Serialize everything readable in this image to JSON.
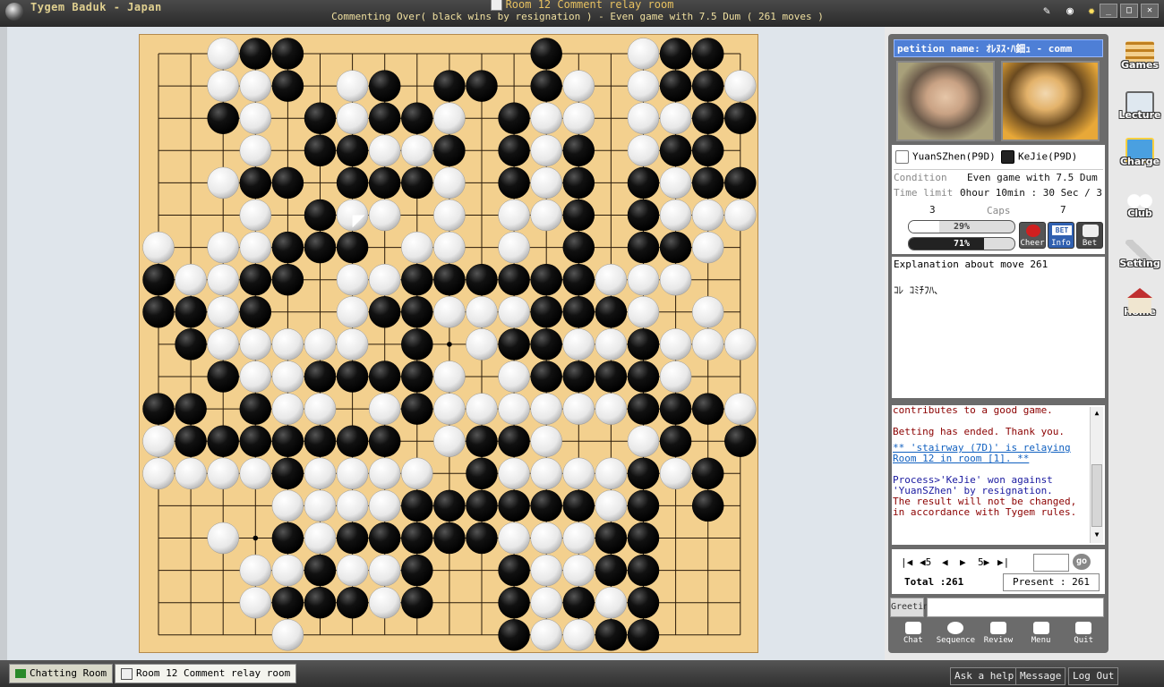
{
  "window": {
    "app_title": "Tygem Baduk - Japan",
    "room_title": "Room 12 Comment relay room",
    "subtitle": "Commenting Over( black wins by resignation ) - Even game with 7.5 Dum  ( 261 moves )"
  },
  "petition": "petition name: ｵﾚﾇｽ･ﾊ鈿ｭ - comm",
  "players": {
    "white": "YuanSZhen(P9D)",
    "black": "KeJie(P9D)"
  },
  "game_info": {
    "condition_label": "Condition",
    "condition_value": "Even game with 7.5 Dum",
    "time_label": "Time limit",
    "time_value": "0hour 10min : 30 Sec / 3",
    "caps_label": "Caps",
    "white_caps": "3",
    "black_caps": "7",
    "white_bet_pct_label": "29%",
    "black_bet_pct_label": "71%",
    "white_bet_fraction": 0.29,
    "black_bet_fraction": 0.71
  },
  "info_buttons": {
    "cheer": "Cheer",
    "info": "Info",
    "bet": "Bet",
    "bet_badge": "BET"
  },
  "explanation": {
    "title": "Explanation about move 261",
    "text": "ｺﾚ ｺﾐﾁﾌﾊ､"
  },
  "chat_lines": [
    {
      "text": "contributes to a good game.",
      "color": "#8b0000"
    },
    {
      "text": "",
      "color": "#000"
    },
    {
      "text": "",
      "color": "#000"
    },
    {
      "text": "Betting has ended. Thank you.",
      "color": "#8b0000"
    },
    {
      "text": "",
      "color": "#000"
    },
    {
      "text": "** 'stairway (7D)' is relaying Room 12 in room [1]. **",
      "color": "#1060c0"
    },
    {
      "text": "",
      "color": "#000"
    },
    {
      "text": "",
      "color": "#000"
    },
    {
      "text": "Process>'KeJie' won against 'YuanSZhen' by resignation.",
      "color": "#1a1aa0"
    },
    {
      "text": "The result will not be changed, in accordance with Tygem rules.",
      "color": "#8b0000"
    }
  ],
  "navigation": {
    "first": "|◀",
    "back5": "◀5",
    "prev": "◀",
    "next": "▶",
    "fwd5": "5▶",
    "last": "▶|",
    "go": "go",
    "total_label": "Total :261",
    "present_label": "Present : 261"
  },
  "greeting_label": "Greeting",
  "bottom_buttons": [
    "Chat",
    "Sequence",
    "Review",
    "Menu",
    "Quit"
  ],
  "sidebar": [
    "Games",
    "Lecture",
    "Charge",
    "Club",
    "Setting",
    "Home"
  ],
  "taskbar": {
    "chatting_room": "Chatting Room",
    "relay_room": "Room 12 Comment relay room",
    "ask_help": "Ask a help",
    "message": "Message",
    "logout": "Log Out"
  },
  "board": {
    "size": 19,
    "last_move": [
      5,
      6
    ],
    "stars": [
      [
        3,
        3
      ],
      [
        3,
        9
      ],
      [
        3,
        15
      ],
      [
        9,
        3
      ],
      [
        9,
        9
      ],
      [
        9,
        15
      ],
      [
        15,
        3
      ],
      [
        15,
        9
      ],
      [
        15,
        15
      ]
    ],
    "rows": [
      "..WBB.......B..WBB.",
      "..WWB.WB.BB.BW.WBBW",
      "..BW.BWBBW.BWW.WWBB",
      "...W.BBWWB.BWB.WBB.",
      "..WBB.BBBW.BWB.BWBB",
      "...W.BWW.W.WWB.BWWW",
      "W.WWBBB.WW.W.B.BBW.",
      "BWWBB.WWBBBBBBWWW..",
      "BBWB..WBBWWWBBBW.W.",
      ".BWWWWW.B.WBBWWBWWW",
      "..BWWBBBBW.WBBBBW..",
      "BB.BWW.WBWWWWWWBBBW",
      "WBBBBBBB.WBBW..WB.B",
      "WWWWBWWWW.BWWWWBWB.",
      "....WWWWBBBBBBWB.B.",
      "..W.BWBBBBBWWWBB...",
      "...WWBWWB..BWWBB...",
      "...WBBBWB..BWBWB...",
      "....W......BWWBB..."
    ]
  }
}
